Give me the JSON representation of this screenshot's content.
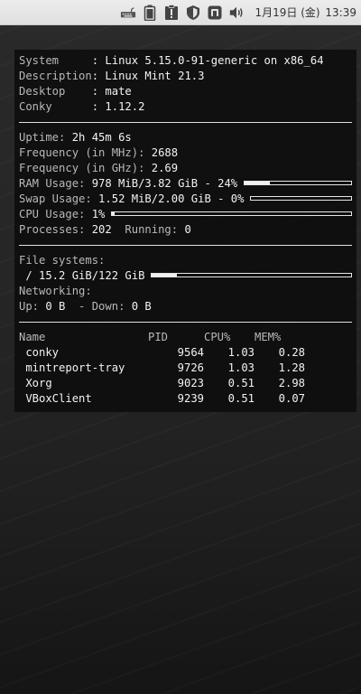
{
  "panel": {
    "tray_icons": [
      "keyboard-icon",
      "battery-icon",
      "update-alert-icon",
      "shield-icon",
      "network-icon",
      "volume-icon"
    ],
    "clock": {
      "date": "1月19日 (金)",
      "time": "13:39"
    }
  },
  "conky": {
    "system_rows": [
      {
        "label": "System     ",
        "value": ": Linux 5.15.0-91-generic on x86_64"
      },
      {
        "label": "Description",
        "value": ": Linux Mint 21.3"
      },
      {
        "label": "Desktop    ",
        "value": ": mate"
      },
      {
        "label": "Conky      ",
        "value": ": 1.12.2"
      }
    ],
    "stats": {
      "uptime_label": "Uptime:",
      "uptime_value": " 2h 45m 6s",
      "freq_mhz_label": "Frequency (in MHz):",
      "freq_mhz_value": " 2688",
      "freq_ghz_label": "Frequency (in GHz):",
      "freq_ghz_value": " 2.69",
      "ram_label": "RAM Usage:",
      "ram_value": " 978 MiB/3.82 GiB - 24%",
      "ram_pct": 24,
      "swap_label": "Swap Usage:",
      "swap_value": " 1.52 MiB/2.00 GiB - 0%",
      "swap_pct": 0,
      "cpu_label": "CPU Usage:",
      "cpu_value": " 1%",
      "cpu_pct": 1,
      "proc_label": "Processes:",
      "proc_value": " 202",
      "running_label": "  Running:",
      "running_value": " 0"
    },
    "fs": {
      "title": "File systems:",
      "root_value": " / 15.2 GiB/122 GiB",
      "root_pct": 12.5,
      "net_title": "Networking:",
      "up_label": "Up:",
      "up_value": " 0 B",
      "down_label": "  - Down:",
      "down_value": " 0 B"
    },
    "procs": {
      "headers": [
        "Name",
        "PID",
        "CPU%",
        "MEM%"
      ],
      "rows": [
        {
          "name": " conky",
          "pid": "9564",
          "cpu": "1.03",
          "mem": "0.28"
        },
        {
          "name": " mintreport-tray",
          "pid": "9726",
          "cpu": "1.03",
          "mem": "1.28"
        },
        {
          "name": " Xorg",
          "pid": "9023",
          "cpu": "0.51",
          "mem": "2.98"
        },
        {
          "name": " VBoxClient",
          "pid": "9239",
          "cpu": "0.51",
          "mem": "0.07"
        }
      ]
    }
  }
}
